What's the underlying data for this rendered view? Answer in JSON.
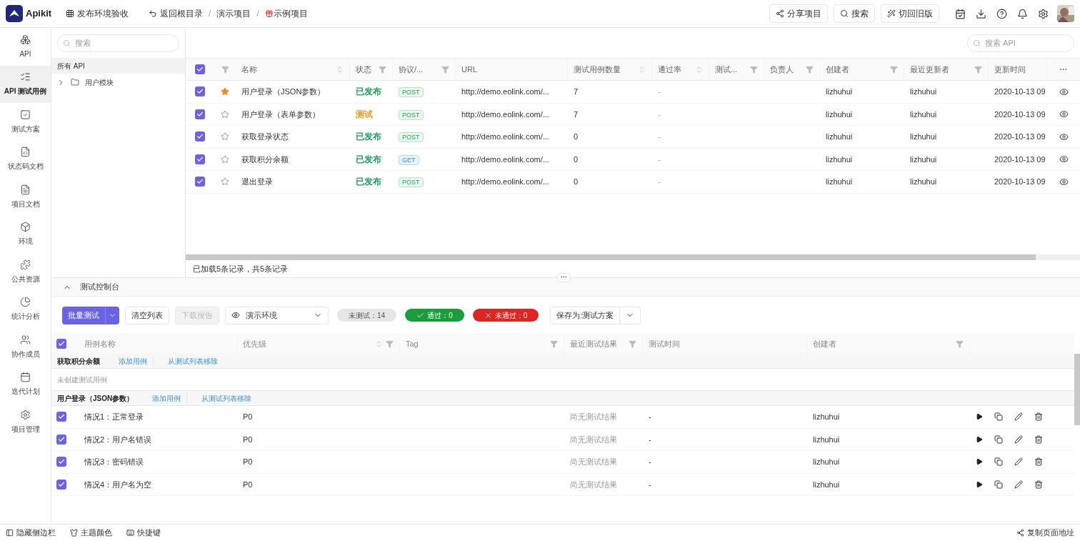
{
  "topbar": {
    "logo": "Apikit",
    "workspace": "发布环境验收",
    "back": "返回根目录",
    "separator": "/",
    "breadcrumb": [
      "演示项目",
      "示例项目"
    ],
    "buttons": [
      {
        "kind": "share",
        "label": "分享项目"
      },
      {
        "kind": "search",
        "label": "搜索"
      },
      {
        "kind": "wand",
        "label": "切回旧版"
      }
    ],
    "avatar": {
      "kind": "picture"
    }
  },
  "nav": [
    {
      "kind": "api",
      "label": "API",
      "selected": false
    },
    {
      "kind": "cases",
      "label": "API 测试用例",
      "selected": true
    },
    {
      "kind": "plan",
      "label": "测试方案",
      "selected": false
    },
    {
      "kind": "code",
      "label": "状态码文档",
      "selected": false
    },
    {
      "kind": "doc",
      "label": "项目文档",
      "selected": false
    },
    {
      "kind": "env",
      "label": "环境",
      "selected": false
    },
    {
      "kind": "puzzle",
      "label": "公共资源",
      "selected": false
    },
    {
      "kind": "chart",
      "label": "统计分析",
      "selected": false
    },
    {
      "kind": "users",
      "label": "协作成员",
      "selected": false
    },
    {
      "kind": "calendar",
      "label": "迭代计划",
      "selected": false
    },
    {
      "kind": "gear",
      "label": "项目管理",
      "selected": false
    }
  ],
  "tree": {
    "placeholder": "搜索",
    "root": "所有 API",
    "items": [
      {
        "label": "用户模块",
        "expanded": false
      }
    ]
  },
  "api_table": {
    "search_placeholder": "搜索 API",
    "all_checked": true,
    "columns": [
      {
        "label": "名称",
        "sort": true,
        "filter": false
      },
      {
        "label": "状态",
        "sort": false,
        "filter": true
      },
      {
        "label": "协议/...",
        "sort": false,
        "filter": true
      },
      {
        "label": "URL",
        "sort": false,
        "filter": false
      },
      {
        "label": "测试用例数量",
        "sort": true,
        "filter": false
      },
      {
        "label": "通过率",
        "sort": true,
        "filter": false
      },
      {
        "label": "测试...",
        "sort": false,
        "filter": true
      },
      {
        "label": "负责人",
        "sort": false,
        "filter": true
      },
      {
        "label": "创建者",
        "sort": false,
        "filter": true
      },
      {
        "label": "最近更新者",
        "sort": false,
        "filter": true
      },
      {
        "label": "更新时间",
        "sort": false,
        "filter": false
      }
    ],
    "more": "···",
    "rows": [
      {
        "checked": true,
        "starred": true,
        "name": "用户登录（JSON参数）",
        "status": "已发布",
        "color": "#1e9e5a",
        "method": "POST",
        "url": "http://demo.eolink.com/...",
        "cases": "7",
        "pass_rate": "-",
        "creator": "lizhuhui",
        "updater": "lizhuhui",
        "updated": "2020-10-13 09"
      },
      {
        "checked": true,
        "starred": false,
        "name": "用户登录（表单参数）",
        "status": "测试",
        "color": "#e79a1e",
        "method": "POST",
        "url": "http://demo.eolink.com/...",
        "cases": "7",
        "pass_rate": "-",
        "creator": "lizhuhui",
        "updater": "lizhuhui",
        "updated": "2020-10-13 09"
      },
      {
        "checked": true,
        "starred": false,
        "name": "获取登录状态",
        "status": "已发布",
        "color": "#1e9e5a",
        "method": "POST",
        "url": "http://demo.eolink.com/...",
        "cases": "0",
        "pass_rate": "-",
        "creator": "lizhuhui",
        "updater": "lizhuhui",
        "updated": "2020-10-13 09"
      },
      {
        "checked": true,
        "starred": false,
        "name": "获取积分余额",
        "status": "已发布",
        "color": "#1e9e5a",
        "method": "GET",
        "url": "http://demo.eolink.com/...",
        "cases": "0",
        "pass_rate": "-",
        "creator": "lizhuhui",
        "updater": "lizhuhui",
        "updated": "2020-10-13 09"
      },
      {
        "checked": true,
        "starred": false,
        "name": "退出登录",
        "status": "已发布",
        "color": "#1e9e5a",
        "method": "POST",
        "url": "http://demo.eolink.com/...",
        "cases": "0",
        "pass_rate": "-",
        "creator": "lizhuhui",
        "updater": "lizhuhui",
        "updated": "2020-10-13 09"
      }
    ],
    "footer": "已加载5条记录，共5条记录"
  },
  "console": {
    "handle": "···",
    "title": "测试控制台",
    "expanded": true,
    "run_button": "批量测试",
    "clear_button": "清空列表",
    "report_button": {
      "label": "下载报告",
      "disabled": true
    },
    "environment": "演示环境",
    "counters": [
      {
        "kind": "untested",
        "label": "未测试：14"
      },
      {
        "kind": "passed",
        "label": "通过：0"
      },
      {
        "kind": "failed",
        "label": "未通过：0"
      }
    ],
    "save_button": "保存为:测试方案",
    "all_checked": true,
    "columns": [
      {
        "label": "用例名称",
        "sort": false,
        "filter": false
      },
      {
        "label": "优先级",
        "sort": true,
        "filter": true
      },
      {
        "label": "Tag",
        "sort": false,
        "filter": true
      },
      {
        "label": "最近测试结果",
        "sort": false,
        "filter": true
      },
      {
        "label": "测试时间",
        "sort": false,
        "filter": false
      },
      {
        "label": "创建者",
        "sort": false,
        "filter": true
      }
    ],
    "groups": [
      {
        "name": "获取积分余额",
        "add_link": "添加用例",
        "remove_link": "从测试列表移除",
        "empty_note": "未创建测试用例"
      },
      {
        "name": "用户登录（JSON参数）",
        "add_link": "添加用例",
        "remove_link": "从测试列表移除",
        "cases": [
          {
            "checked": true,
            "name": "情况1：正常登录",
            "priority": "P0",
            "result": "尚无测试结果",
            "time": "-",
            "creator": "lizhuhui"
          },
          {
            "checked": true,
            "name": "情况2：用户名错误",
            "priority": "P0",
            "result": "尚无测试结果",
            "time": "-",
            "creator": "lizhuhui"
          },
          {
            "checked": true,
            "name": "情况3：密码错误",
            "priority": "P0",
            "result": "尚无测试结果",
            "time": "-",
            "creator": "lizhuhui"
          },
          {
            "checked": true,
            "name": "情况4：用户名为空",
            "priority": "P0",
            "result": "尚无测试结果",
            "time": "-",
            "creator": "lizhuhui"
          }
        ]
      }
    ]
  },
  "status_bar": {
    "left": [
      {
        "kind": "sidebar",
        "label": "隐藏侧边栏"
      },
      {
        "kind": "shirt",
        "label": "主题颜色"
      },
      {
        "kind": "keyboard",
        "label": "快捷键"
      }
    ],
    "right": {
      "label": "复制页面地址"
    }
  }
}
